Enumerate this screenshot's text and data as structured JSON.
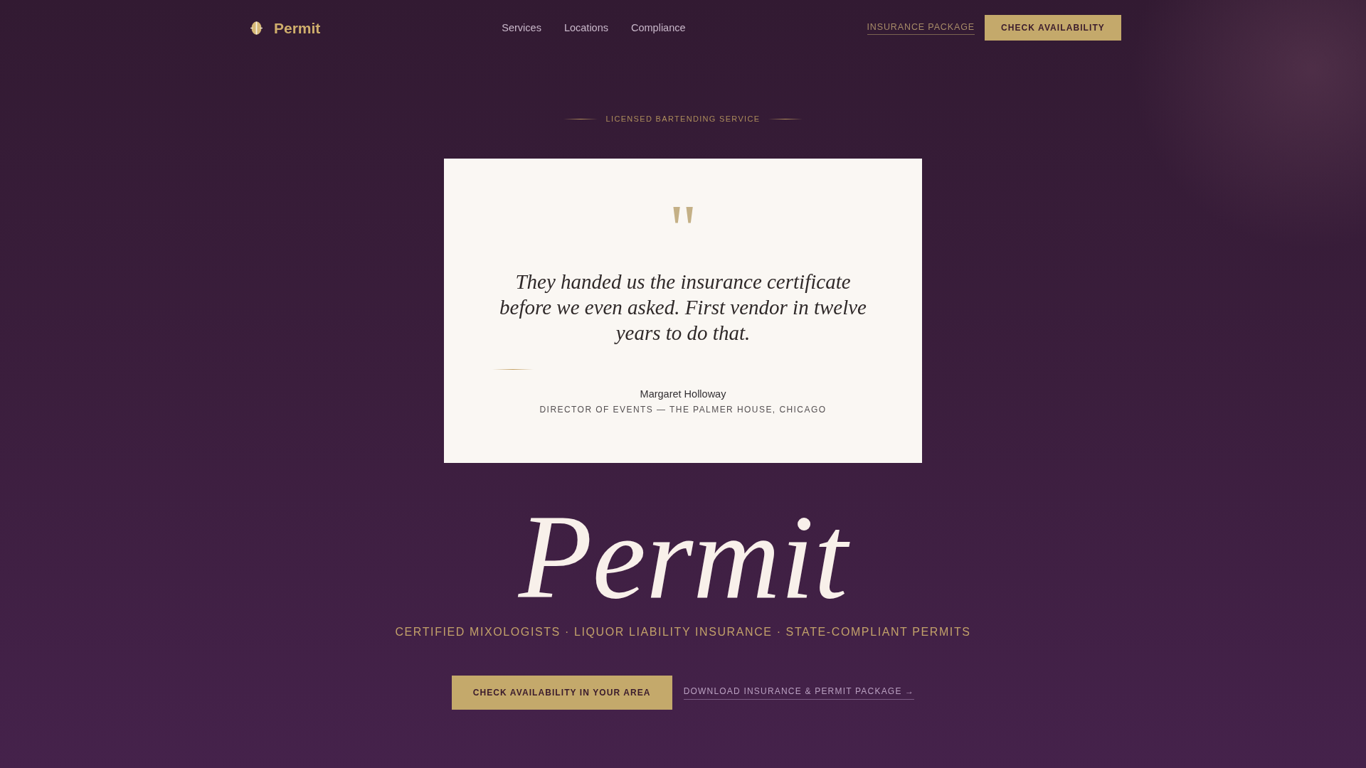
{
  "header": {
    "brand": "Permit",
    "nav": [
      {
        "label": "Services"
      },
      {
        "label": "Locations"
      },
      {
        "label": "Compliance"
      }
    ],
    "insurance_link": "INSURANCE PACKAGE",
    "cta_button": "CHECK AVAILABILITY"
  },
  "hero": {
    "eyebrow": "LICENSED BARTENDING SERVICE",
    "testimonial": {
      "quote_mark": "\"",
      "quote": "They handed us the insurance certificate before we even asked. First vendor in twelve years to do that.",
      "author": "Margaret Holloway",
      "role": "DIRECTOR OF EVENTS — THE PALMER HOUSE, CHICAGO"
    },
    "title": "Permit",
    "tagline": "CERTIFIED MIXOLOGISTS · LIQUOR LIABILITY INSURANCE · STATE-COMPLIANT PERMITS",
    "primary_button": "CHECK AVAILABILITY IN YOUR AREA",
    "secondary_link": "DOWNLOAD INSURANCE & PERMIT PACKAGE →"
  }
}
